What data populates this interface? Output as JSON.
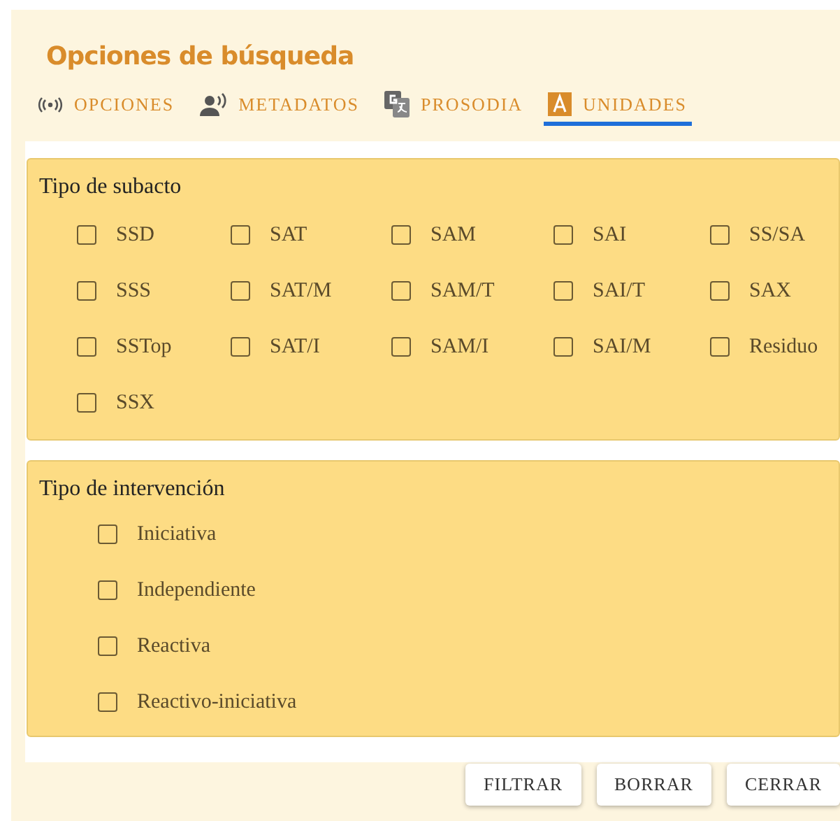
{
  "title": "Opciones de búsqueda",
  "tabs": [
    {
      "label": "OPCIONES",
      "kind": "signal",
      "selected": false
    },
    {
      "label": "METADATOS",
      "kind": "speaker",
      "selected": false
    },
    {
      "label": "PROSODIA",
      "kind": "translate",
      "selected": false
    },
    {
      "label": "UNIDADES",
      "kind": "letter",
      "selected": true
    }
  ],
  "subacto": {
    "title": "Tipo de subacto",
    "options": [
      {
        "label": "SSD",
        "checked": false
      },
      {
        "label": "SAT",
        "checked": false
      },
      {
        "label": "SAM",
        "checked": false
      },
      {
        "label": "SAI",
        "checked": false
      },
      {
        "label": "SS/SA",
        "checked": false
      },
      {
        "label": "SSS",
        "checked": false
      },
      {
        "label": "SAT/M",
        "checked": false
      },
      {
        "label": "SAM/T",
        "checked": false
      },
      {
        "label": "SAI/T",
        "checked": false
      },
      {
        "label": "SAX",
        "checked": false
      },
      {
        "label": "SSTop",
        "checked": false
      },
      {
        "label": "SAT/I",
        "checked": false
      },
      {
        "label": "SAM/I",
        "checked": false
      },
      {
        "label": "SAI/M",
        "checked": false
      },
      {
        "label": "Residuo",
        "checked": false
      },
      {
        "label": "SSX",
        "checked": false
      }
    ]
  },
  "intervencion": {
    "title": "Tipo de intervención",
    "options": [
      {
        "label": "Iniciativa",
        "checked": false
      },
      {
        "label": "Independiente",
        "checked": false
      },
      {
        "label": "Reactiva",
        "checked": false
      },
      {
        "label": "Reactivo-iniciativa",
        "checked": false
      }
    ]
  },
  "buttons": [
    "FILTRAR",
    "BORRAR",
    "CERRAR"
  ]
}
